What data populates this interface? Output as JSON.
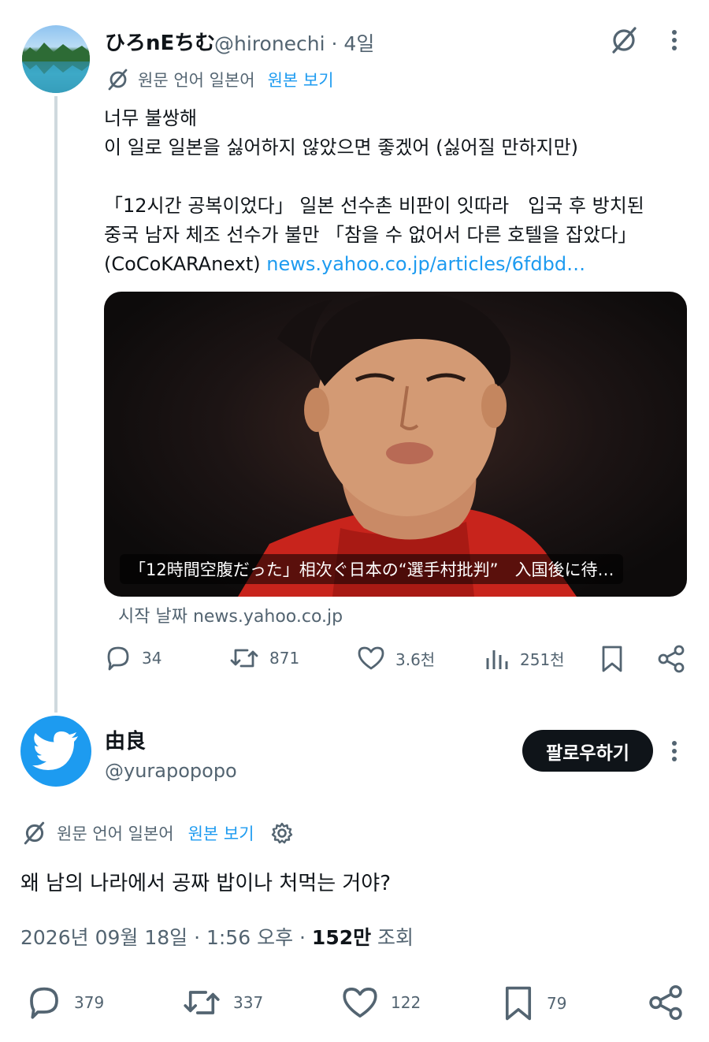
{
  "tweet1": {
    "display_name": "ひろnEちむ",
    "handle_time": "@hironechi · 4일",
    "translation": {
      "label": "원문 언어 일본어",
      "link": "원본 보기"
    },
    "text": "너무 불쌍해\n이 일로 일본을 싫어하지 않았으면 좋겠어 (싫어질 만하지만)\n\n「12시간 공복이었다」 일본 선수촌 비판이 잇따라　입국 후 방치된\n중국 남자 체조 선수가 불만 「참을 수 없어서 다른 호텔을 잡았다」\n(CoCoKARAnext) ",
    "text_link": "news.yahoo.co.jp/articles/6fdbd…",
    "card": {
      "caption": "「12時間空腹だった」相次ぐ日本の“選手村批判”　入国後に待…",
      "source": "시작 날짜 news.yahoo.co.jp"
    },
    "actions": {
      "replies": "34",
      "reposts": "871",
      "likes": "3.6천",
      "views": "251천"
    }
  },
  "tweet2": {
    "display_name": "由良",
    "handle": "@yurapopopo",
    "follow_label": "팔로우하기",
    "translation": {
      "label": "원문 언어 일본어",
      "link": "원본 보기"
    },
    "text": "왜 남의 나라에서 공짜 밥이나 처먹는 거야?",
    "meta": {
      "datetime": "2026년 09월 18일 · 1:56 오후 · ",
      "views_count": "152만",
      "views_label": " 조회"
    },
    "actions": {
      "replies": "379",
      "reposts": "337",
      "likes": "122",
      "bookmarks": "79"
    }
  },
  "icons": [
    "grok-icon",
    "more-icon",
    "translate-icon",
    "reply-icon",
    "repost-icon",
    "like-icon",
    "views-icon",
    "bookmark-icon",
    "share-icon",
    "settings-icon",
    "twitter-bird-icon"
  ],
  "colors": {
    "link": "#1d9bf0",
    "muted": "#536471",
    "text": "#0f1419",
    "thread_line": "#cfd9de"
  }
}
